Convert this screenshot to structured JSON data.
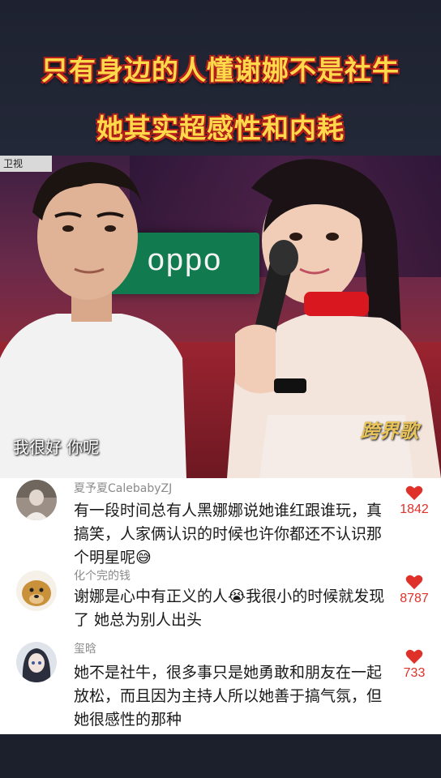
{
  "headline": {
    "line1": "只有身边的人懂谢娜不是社牛",
    "line2": "她其实超感性和内耗"
  },
  "video": {
    "corner_tag": "卫视",
    "sign": "oppo",
    "subtitle": "我很好 你呢",
    "watermark": "跨界歌"
  },
  "comments": [
    {
      "name": "夏予夏CalebabyZJ",
      "text": "有一段时间总有人黑娜娜说她谁红跟谁玩，真搞笑，人家俩认识的时候也许你都还不认识那个明星呢😅",
      "likes": "1842"
    },
    {
      "name": "化个完的钱",
      "text": "谢娜是心中有正义的人😭我很小的时候就发现了 她总为别人出头",
      "likes": "8787"
    },
    {
      "name": "玺晗",
      "text": "她不是社牛，很多事只是她勇敢和朋友在一起放松，而且因为主持人所以她善于搞气氛，但她很感性的那种",
      "likes": "733"
    }
  ],
  "colors": {
    "headline_fill": "#ffd94a",
    "headline_stroke": "#b3201b",
    "like_red": "#e0302a",
    "background": "#1c202c"
  },
  "icons": {
    "like": "heart-icon",
    "share": "share-icon"
  }
}
